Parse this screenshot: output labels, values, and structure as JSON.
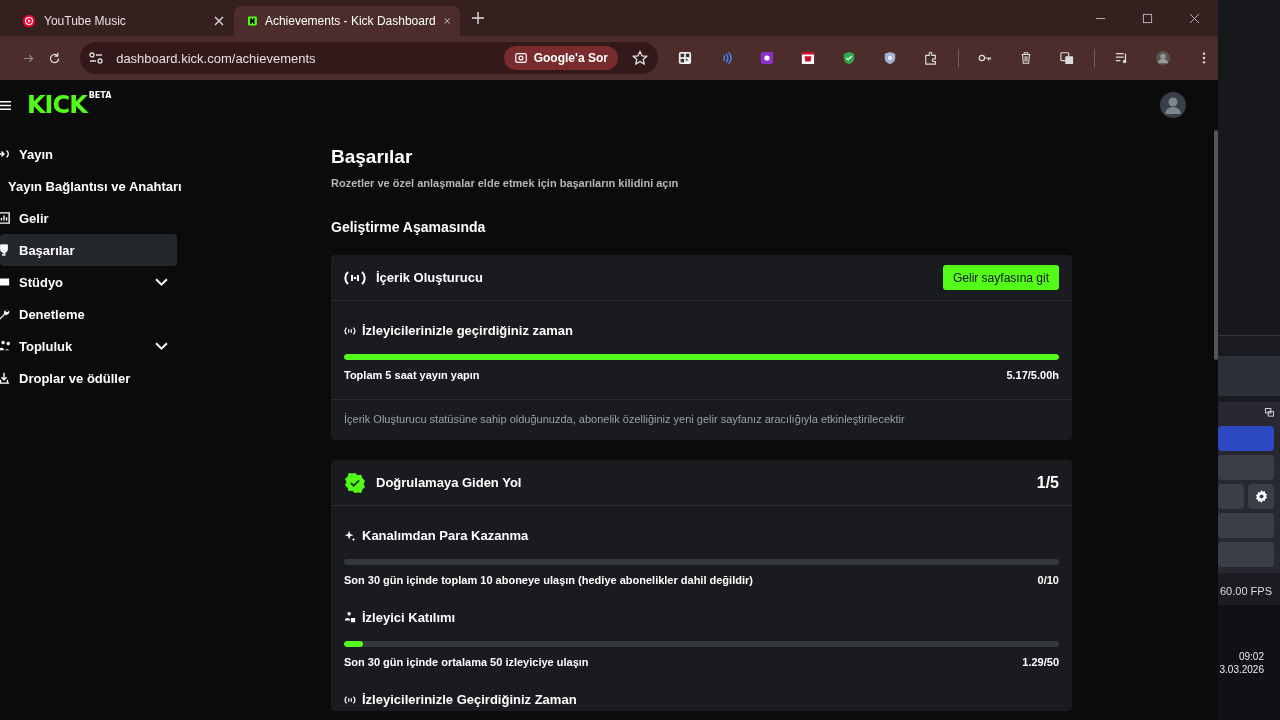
{
  "browser": {
    "tabs": [
      {
        "title": "YouTube Music",
        "selected": false,
        "kind": "youtube"
      },
      {
        "title": "Achievements - Kick Dashboard",
        "selected": true,
        "kind": "kick"
      }
    ],
    "address": "dashboard.kick.com/achievements",
    "ask_button": "Google'a Sor"
  },
  "logo": {
    "text": "KICK",
    "badge": "BETA"
  },
  "sidebar": {
    "items": [
      {
        "label": "Yayın",
        "selected": false,
        "expandable": false
      },
      {
        "label": "Yayın Bağlantısı ve Anahtarı",
        "selected": false,
        "expandable": false
      },
      {
        "label": "Gelir",
        "selected": false,
        "expandable": false
      },
      {
        "label": "Başarılar",
        "selected": true,
        "expandable": false
      },
      {
        "label": "Stüdyo",
        "selected": false,
        "expandable": true
      },
      {
        "label": "Denetleme",
        "selected": false,
        "expandable": false
      },
      {
        "label": "Topluluk",
        "selected": false,
        "expandable": true
      },
      {
        "label": "Droplar ve ödüller",
        "selected": false,
        "expandable": false
      }
    ]
  },
  "main": {
    "title": "Başarılar",
    "subtitle": "Rozetler ve özel anlaşmalar elde etmek için başarıların kilidini açın",
    "section_title": "Geliştirme Aşamasında",
    "cards": [
      {
        "kind": "creator",
        "title": "İçerik Oluşturucu",
        "button": "Gelir sayfasına git",
        "goals": [
          {
            "title": "İzleyicilerinizle geçirdiğiniz zaman",
            "description": "Toplam 5 saat yayın yapın",
            "progress": "5.17/5.00h",
            "level": 1
          }
        ],
        "note": "İçerik Oluşturucu statüsüne sahip olduğunuzda, abonelik özelliğiniz yeni gelir sayfanız aracılığıyla etkinleştirilecektir"
      },
      {
        "kind": "verified",
        "title": "Doğrulamaya Giden Yol",
        "count": "1/5",
        "goals": [
          {
            "title": "Kanalımdan Para Kazanma",
            "description": "Son 30 gün içinde toplam 10 aboneye ulaşın (hediye abonelikler dahil değildir)",
            "progress": "0/10",
            "level": 0
          },
          {
            "title": "İzleyici Katılımı",
            "description": "Son 30 gün içinde ortalama 50 izleyiciye ulaşın",
            "progress": "1.29/50",
            "level": 0.026
          },
          {
            "title": "İzleyicilerinizle Geçirdiğiniz Zaman"
          }
        ]
      }
    ]
  },
  "side_app": {
    "fps": "60.00 FPS"
  },
  "taskbar": {
    "time": "09:02",
    "date": "3.03.2026"
  }
}
